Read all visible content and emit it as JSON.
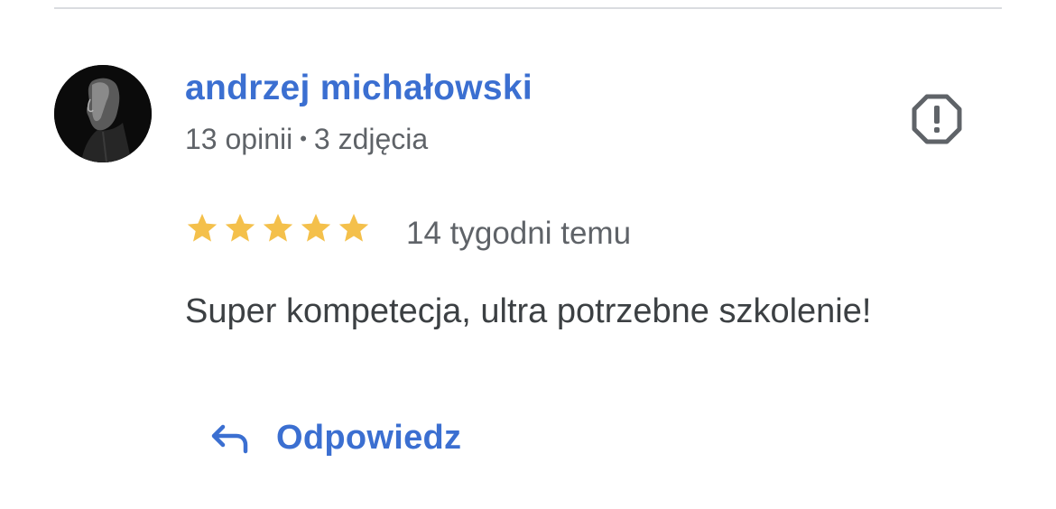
{
  "review": {
    "author": {
      "name": "andrzej michałowski",
      "reviews_count": "13 opinii",
      "separator": "•",
      "photos_count": "3 zdjęcia"
    },
    "rating": 5,
    "max_rating": 5,
    "time_ago": "14 tygodni temu",
    "text": "Super kompetecja, ultra potrzebne szkolenie!",
    "reply_label": "Odpowiedz"
  },
  "colors": {
    "accent": "#3b6fd1",
    "star": "#f4c04b",
    "muted_text": "#5f6368",
    "body_text": "#3c4043",
    "divider": "#dadce0"
  },
  "icons": {
    "report": "report-flag-octagon-icon",
    "reply": "reply-arrow-icon",
    "star": "star-icon"
  }
}
